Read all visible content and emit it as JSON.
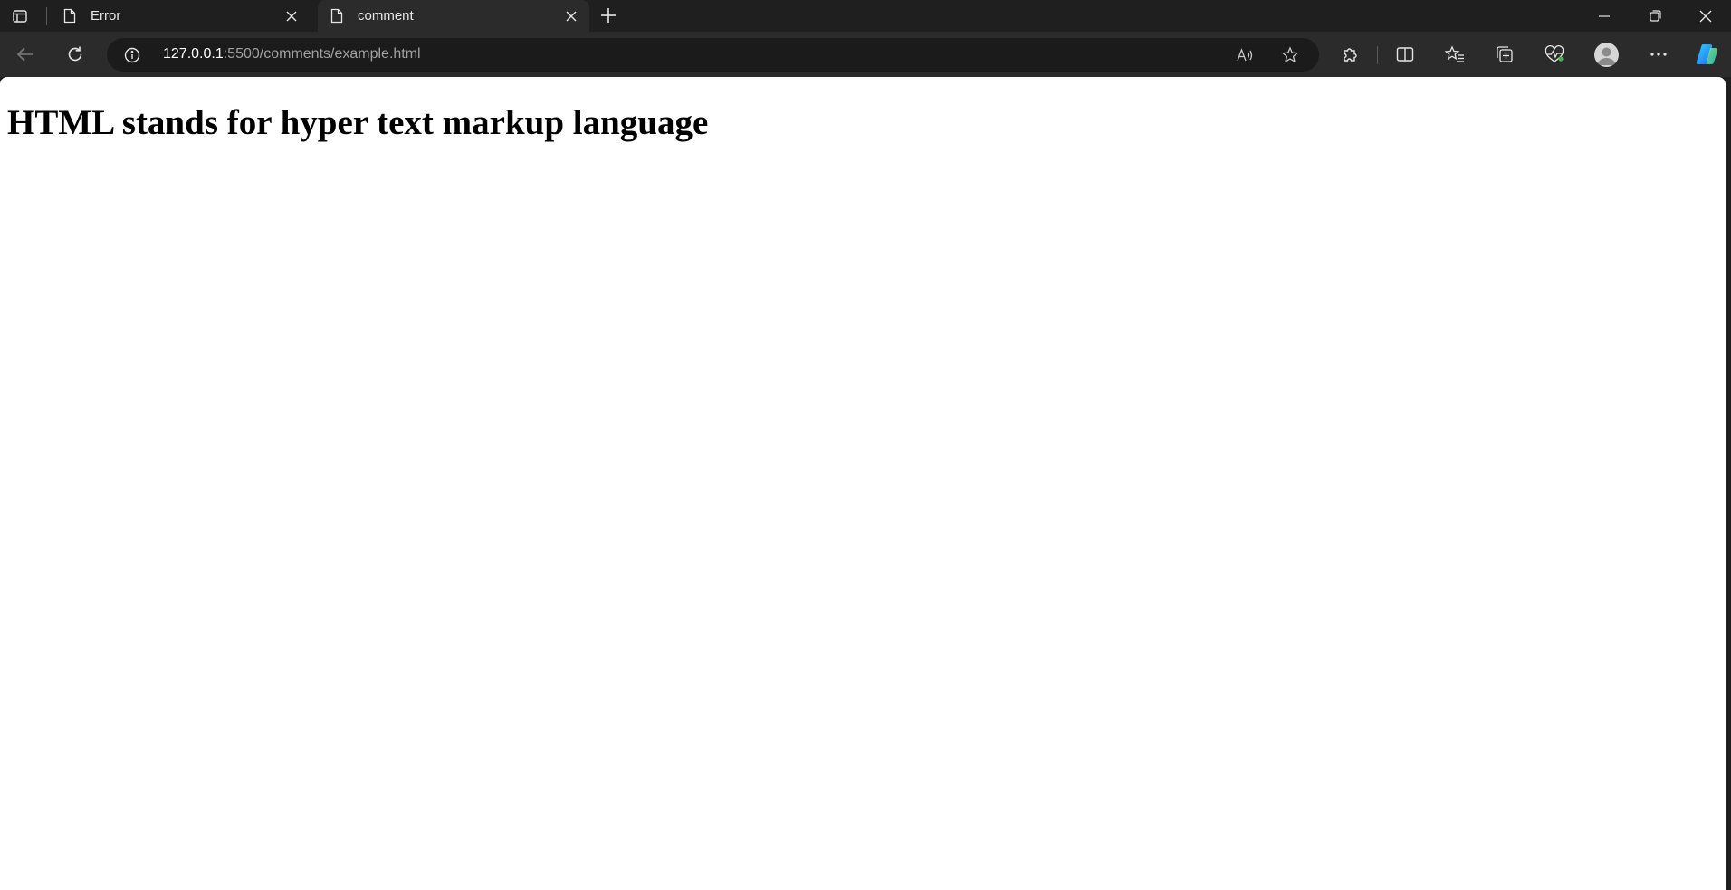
{
  "tabs": [
    {
      "title": "Error",
      "active": false
    },
    {
      "title": "comment",
      "active": true
    }
  ],
  "address": {
    "host": "127.0.0.1",
    "rest": ":5500/comments/example.html"
  },
  "page": {
    "heading": "HTML stands for hyper text markup language"
  },
  "colors": {
    "chrome_bg": "#1f1f1f",
    "toolbar_bg": "#2b2b2b",
    "addressbar_bg": "#1b1b1b",
    "page_bg": "#ffffff"
  },
  "icons": {
    "tab_actions": "tab-actions-icon",
    "tab_page": "page-icon",
    "tab_close": "close-icon",
    "new_tab": "plus-icon",
    "minimize": "minimize-icon",
    "restore": "restore-icon",
    "close_window": "close-icon",
    "back": "back-arrow-icon",
    "refresh": "refresh-icon",
    "site_info": "info-icon",
    "read_aloud": "read-aloud-icon",
    "favorite": "star-icon",
    "extensions": "puzzle-icon",
    "split_screen": "split-screen-icon",
    "favorites": "favorites-list-icon",
    "collections": "collections-icon",
    "browser_essentials": "heart-pulse-icon",
    "profile": "profile-icon",
    "more": "more-icon",
    "copilot": "copilot-icon"
  }
}
